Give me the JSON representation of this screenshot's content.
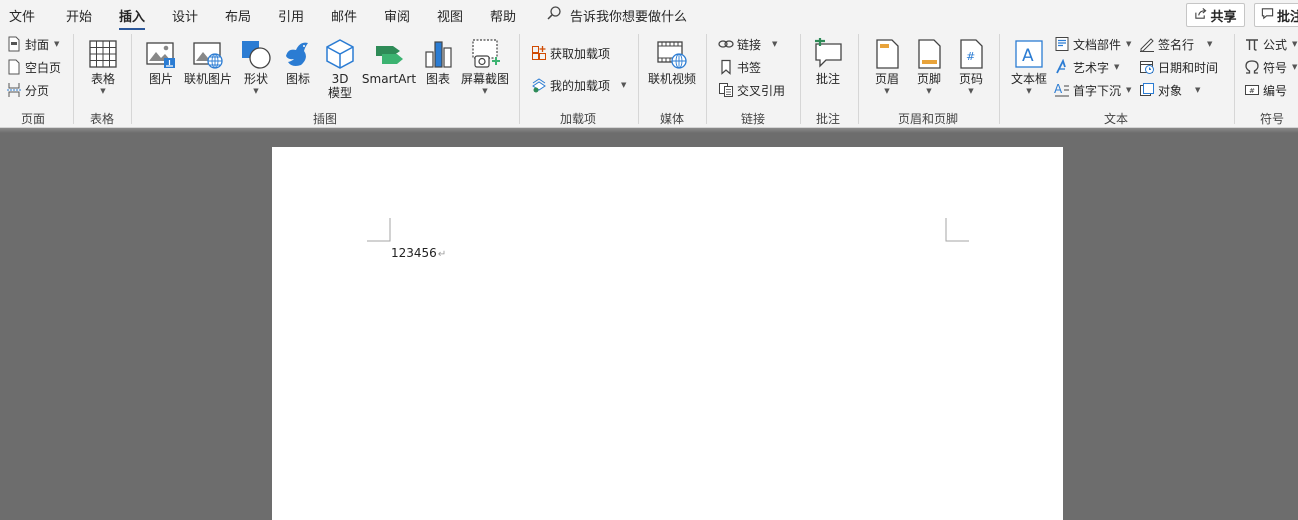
{
  "tabs": [
    {
      "label": "文件"
    },
    {
      "label": "开始"
    },
    {
      "label": "插入"
    },
    {
      "label": "设计"
    },
    {
      "label": "布局"
    },
    {
      "label": "引用"
    },
    {
      "label": "邮件"
    },
    {
      "label": "审阅"
    },
    {
      "label": "视图"
    },
    {
      "label": "帮助"
    }
  ],
  "active_tab": "插入",
  "tell_me": "告诉我你想要做什么",
  "share_label": "共享",
  "comments_label": "批注",
  "groups": {
    "pages": {
      "label": "页面",
      "cover": "封面",
      "blank": "空白页",
      "break": "分页"
    },
    "tables": {
      "label": "表格",
      "table": "表格"
    },
    "illustrations": {
      "label": "插图",
      "picture": "图片",
      "online_picture": "联机图片",
      "shapes": "形状",
      "icons": "图标",
      "model3d_line1": "3D",
      "model3d_line2": "模型",
      "smartart": "SmartArt",
      "chart": "图表",
      "screenshot": "屏幕截图"
    },
    "addins": {
      "label": "加载项",
      "get": "获取加载项",
      "mine": "我的加载项"
    },
    "media": {
      "label": "媒体",
      "online_video": "联机视频"
    },
    "links": {
      "label": "链接",
      "link": "链接",
      "bookmark": "书签",
      "cross_ref": "交叉引用"
    },
    "comments": {
      "label": "批注",
      "comment": "批注"
    },
    "header_footer": {
      "label": "页眉和页脚",
      "header": "页眉",
      "footer": "页脚",
      "page_number": "页码"
    },
    "text": {
      "label": "文本",
      "textbox": "文本框",
      "quick_parts": "文档部件",
      "wordart": "艺术字",
      "dropcap": "首字下沉",
      "signature": "签名行",
      "datetime": "日期和时间",
      "object": "对象"
    },
    "symbols": {
      "label": "符号",
      "equation": "公式",
      "symbol": "符号",
      "number": "编号"
    }
  },
  "document": {
    "text": "123456",
    "para_mark": "↵"
  },
  "colors": {
    "accent": "#2b579a",
    "ribbon_bg": "#f3f3f3",
    "canvas_bg": "#6d6d6d"
  }
}
